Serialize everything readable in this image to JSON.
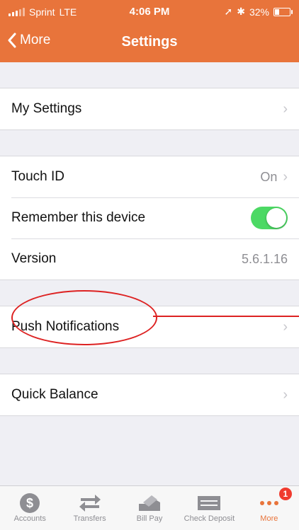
{
  "status_bar": {
    "carrier": "Sprint",
    "network": "LTE",
    "time": "4:06 PM",
    "battery": "32%",
    "battery_level": 0.32
  },
  "nav": {
    "back_label": "More",
    "title": "Settings"
  },
  "groups": {
    "g1": {
      "my_settings": "My Settings"
    },
    "g2": {
      "touch_id": "Touch ID",
      "touch_id_value": "On",
      "remember": "Remember this device",
      "version": "Version",
      "version_value": "5.6.1.16"
    },
    "g3": {
      "push": "Push Notifications"
    },
    "g4": {
      "quick_balance": "Quick Balance"
    }
  },
  "tabs": {
    "accounts": "Accounts",
    "transfers": "Transfers",
    "billpay": "Bill Pay",
    "checkdeposit": "Check Deposit",
    "more": "More",
    "more_badge": "1"
  },
  "colors": {
    "accent": "#e8743b",
    "toggle_on": "#4cd964",
    "annotation": "#dd2222",
    "badge": "#f03a2e"
  }
}
